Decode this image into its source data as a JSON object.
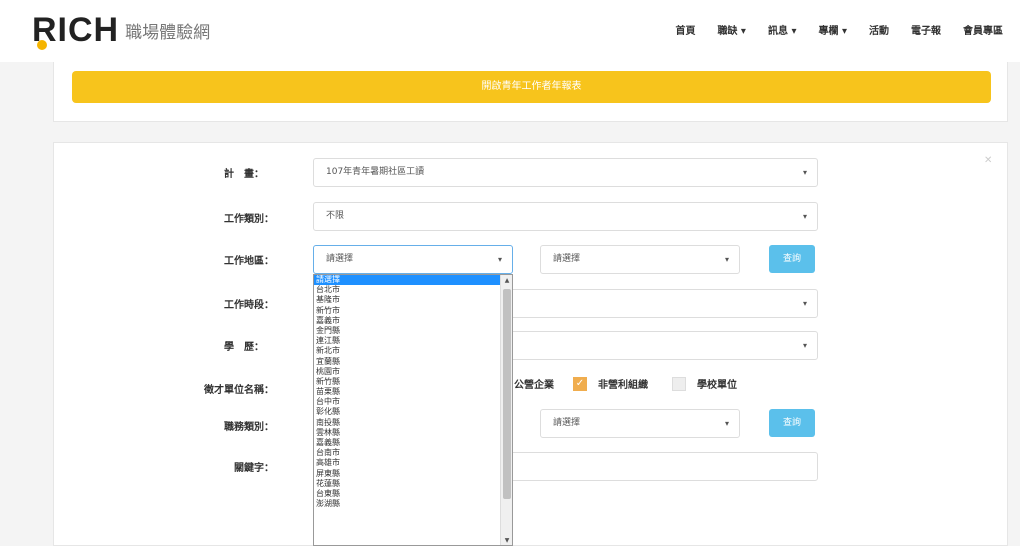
{
  "header": {
    "logo": "RICH",
    "site_name": "職場體驗網",
    "nav": [
      "首頁",
      "職缺 ▾",
      "訊息 ▾",
      "專欄 ▾",
      "活動",
      "電子報",
      "會員專區"
    ]
  },
  "banner": {
    "label": "開啟青年工作者年報表"
  },
  "form": {
    "plan_label": "計　畫：",
    "plan_value": "107年青年暑期社區工讀",
    "job_type_label": "工作類別：",
    "job_type_value": "不限",
    "location_label": "工作地區：",
    "location_city": "請選擇",
    "location_district": "請選擇",
    "query_label": "查詢",
    "period_label": "工作時段：",
    "education_label": "學　歷：",
    "org_label": "徵才單位名稱：",
    "chk_public": "公營企業",
    "chk_npo": "非營利組織",
    "chk_school": "學校單位",
    "dept_label": "職務類別：",
    "dept_value": "請選擇",
    "query_label2": "查詢",
    "keyword_label": "關鍵字："
  },
  "dropdown": {
    "options": [
      "請選擇",
      "台北市",
      "基隆市",
      "新竹市",
      "嘉義市",
      "金門縣",
      "連江縣",
      "新北市",
      "宜蘭縣",
      "桃園市",
      "新竹縣",
      "苗栗縣",
      "台中市",
      "彰化縣",
      "南投縣",
      "雲林縣",
      "嘉義縣",
      "台南市",
      "高雄市",
      "屏東縣",
      "花蓮縣",
      "台東縣",
      "澎湖縣"
    ],
    "selected": "請選擇"
  }
}
